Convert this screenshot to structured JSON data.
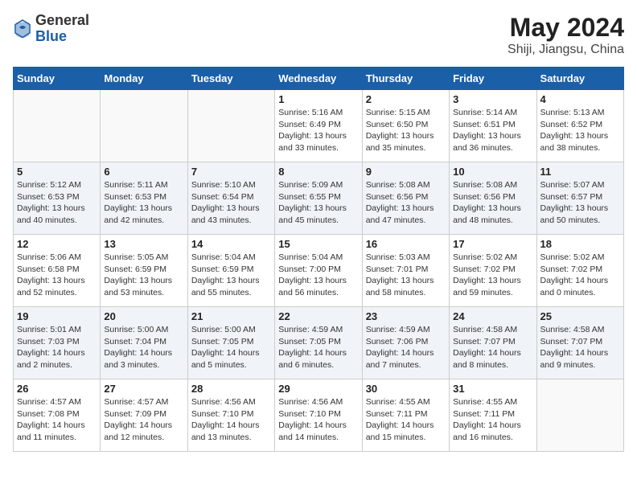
{
  "header": {
    "logo_general": "General",
    "logo_blue": "Blue",
    "title": "May 2024",
    "subtitle": "Shiji, Jiangsu, China"
  },
  "weekdays": [
    "Sunday",
    "Monday",
    "Tuesday",
    "Wednesday",
    "Thursday",
    "Friday",
    "Saturday"
  ],
  "weeks": [
    [
      {
        "day": "",
        "info": ""
      },
      {
        "day": "",
        "info": ""
      },
      {
        "day": "",
        "info": ""
      },
      {
        "day": "1",
        "info": "Sunrise: 5:16 AM\nSunset: 6:49 PM\nDaylight: 13 hours and 33 minutes."
      },
      {
        "day": "2",
        "info": "Sunrise: 5:15 AM\nSunset: 6:50 PM\nDaylight: 13 hours and 35 minutes."
      },
      {
        "day": "3",
        "info": "Sunrise: 5:14 AM\nSunset: 6:51 PM\nDaylight: 13 hours and 36 minutes."
      },
      {
        "day": "4",
        "info": "Sunrise: 5:13 AM\nSunset: 6:52 PM\nDaylight: 13 hours and 38 minutes."
      }
    ],
    [
      {
        "day": "5",
        "info": "Sunrise: 5:12 AM\nSunset: 6:53 PM\nDaylight: 13 hours and 40 minutes."
      },
      {
        "day": "6",
        "info": "Sunrise: 5:11 AM\nSunset: 6:53 PM\nDaylight: 13 hours and 42 minutes."
      },
      {
        "day": "7",
        "info": "Sunrise: 5:10 AM\nSunset: 6:54 PM\nDaylight: 13 hours and 43 minutes."
      },
      {
        "day": "8",
        "info": "Sunrise: 5:09 AM\nSunset: 6:55 PM\nDaylight: 13 hours and 45 minutes."
      },
      {
        "day": "9",
        "info": "Sunrise: 5:08 AM\nSunset: 6:56 PM\nDaylight: 13 hours and 47 minutes."
      },
      {
        "day": "10",
        "info": "Sunrise: 5:08 AM\nSunset: 6:56 PM\nDaylight: 13 hours and 48 minutes."
      },
      {
        "day": "11",
        "info": "Sunrise: 5:07 AM\nSunset: 6:57 PM\nDaylight: 13 hours and 50 minutes."
      }
    ],
    [
      {
        "day": "12",
        "info": "Sunrise: 5:06 AM\nSunset: 6:58 PM\nDaylight: 13 hours and 52 minutes."
      },
      {
        "day": "13",
        "info": "Sunrise: 5:05 AM\nSunset: 6:59 PM\nDaylight: 13 hours and 53 minutes."
      },
      {
        "day": "14",
        "info": "Sunrise: 5:04 AM\nSunset: 6:59 PM\nDaylight: 13 hours and 55 minutes."
      },
      {
        "day": "15",
        "info": "Sunrise: 5:04 AM\nSunset: 7:00 PM\nDaylight: 13 hours and 56 minutes."
      },
      {
        "day": "16",
        "info": "Sunrise: 5:03 AM\nSunset: 7:01 PM\nDaylight: 13 hours and 58 minutes."
      },
      {
        "day": "17",
        "info": "Sunrise: 5:02 AM\nSunset: 7:02 PM\nDaylight: 13 hours and 59 minutes."
      },
      {
        "day": "18",
        "info": "Sunrise: 5:02 AM\nSunset: 7:02 PM\nDaylight: 14 hours and 0 minutes."
      }
    ],
    [
      {
        "day": "19",
        "info": "Sunrise: 5:01 AM\nSunset: 7:03 PM\nDaylight: 14 hours and 2 minutes."
      },
      {
        "day": "20",
        "info": "Sunrise: 5:00 AM\nSunset: 7:04 PM\nDaylight: 14 hours and 3 minutes."
      },
      {
        "day": "21",
        "info": "Sunrise: 5:00 AM\nSunset: 7:05 PM\nDaylight: 14 hours and 5 minutes."
      },
      {
        "day": "22",
        "info": "Sunrise: 4:59 AM\nSunset: 7:05 PM\nDaylight: 14 hours and 6 minutes."
      },
      {
        "day": "23",
        "info": "Sunrise: 4:59 AM\nSunset: 7:06 PM\nDaylight: 14 hours and 7 minutes."
      },
      {
        "day": "24",
        "info": "Sunrise: 4:58 AM\nSunset: 7:07 PM\nDaylight: 14 hours and 8 minutes."
      },
      {
        "day": "25",
        "info": "Sunrise: 4:58 AM\nSunset: 7:07 PM\nDaylight: 14 hours and 9 minutes."
      }
    ],
    [
      {
        "day": "26",
        "info": "Sunrise: 4:57 AM\nSunset: 7:08 PM\nDaylight: 14 hours and 11 minutes."
      },
      {
        "day": "27",
        "info": "Sunrise: 4:57 AM\nSunset: 7:09 PM\nDaylight: 14 hours and 12 minutes."
      },
      {
        "day": "28",
        "info": "Sunrise: 4:56 AM\nSunset: 7:10 PM\nDaylight: 14 hours and 13 minutes."
      },
      {
        "day": "29",
        "info": "Sunrise: 4:56 AM\nSunset: 7:10 PM\nDaylight: 14 hours and 14 minutes."
      },
      {
        "day": "30",
        "info": "Sunrise: 4:55 AM\nSunset: 7:11 PM\nDaylight: 14 hours and 15 minutes."
      },
      {
        "day": "31",
        "info": "Sunrise: 4:55 AM\nSunset: 7:11 PM\nDaylight: 14 hours and 16 minutes."
      },
      {
        "day": "",
        "info": ""
      }
    ]
  ]
}
